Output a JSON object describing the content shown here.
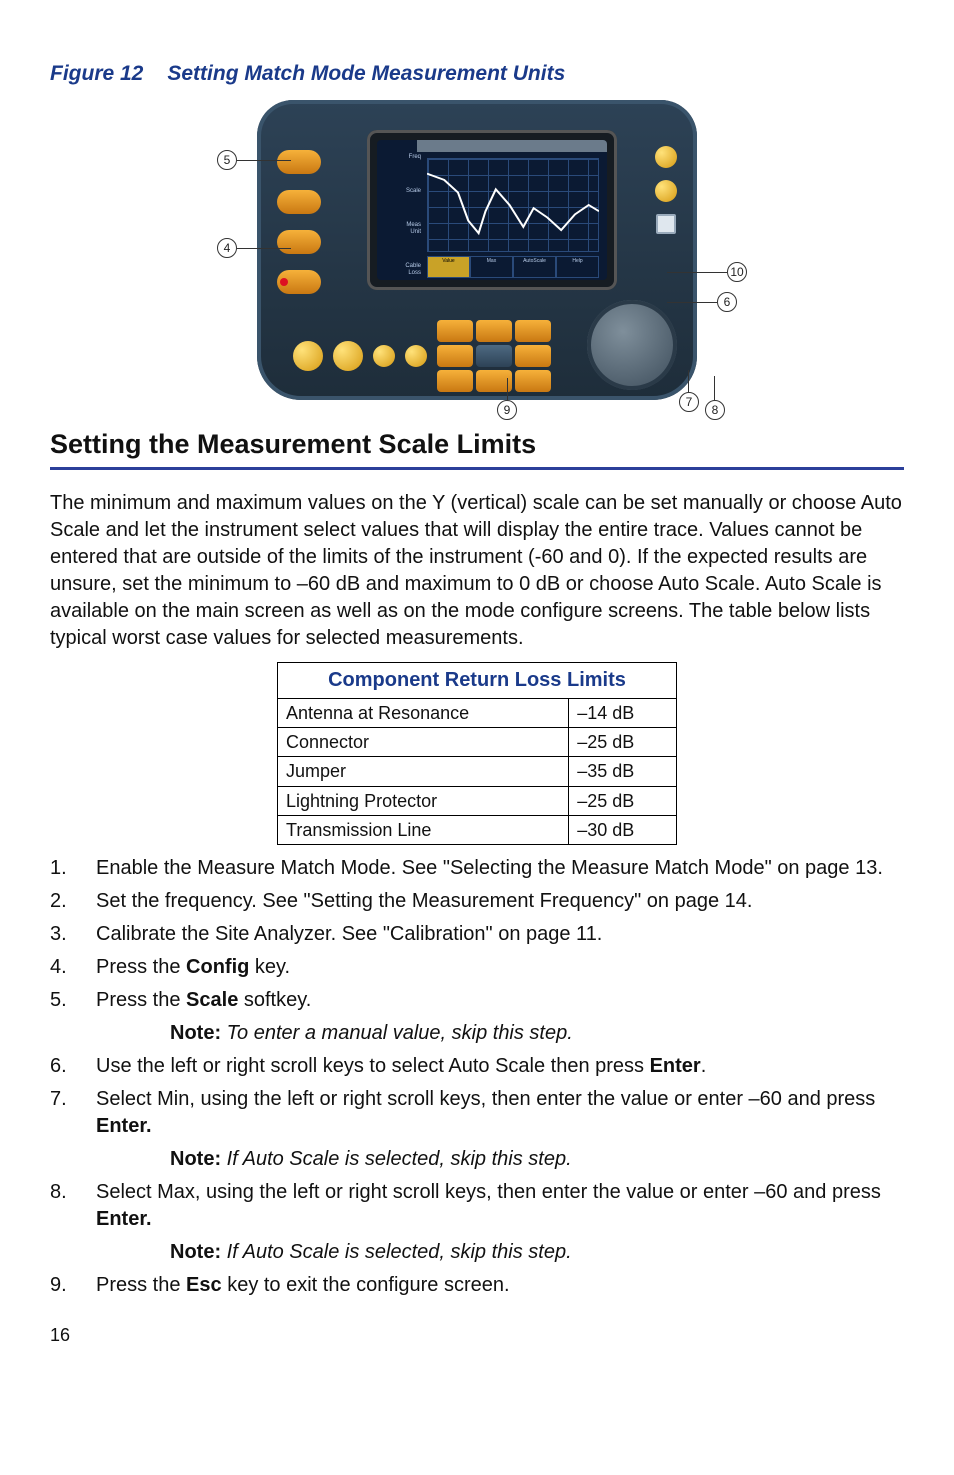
{
  "figure": {
    "label": "Figure 12",
    "title": "Setting Match Mode Measurement Units",
    "callouts": {
      "c4": "4",
      "c5": "5",
      "c6": "6",
      "c7": "7",
      "c8": "8",
      "c9": "9",
      "c10": "10"
    }
  },
  "section_heading": "Setting the Measurement Scale Limits",
  "intro": "The minimum and maximum values on the Y (vertical) scale can be set manually or choose Auto Scale and let the instrument select values that will display the entire trace. Values cannot be entered that are outside of the limits of the instrument (-60 and 0). If the expected results are unsure, set the minimum to –60 dB and maximum to 0 dB or choose Auto Scale. Auto Scale is available on the main screen as well as on the mode configure screens. The table below lists typical worst case values for selected measurements.",
  "table": {
    "title": "Component Return Loss Limits",
    "rows": [
      {
        "name": "Antenna at Resonance",
        "value": "–14 dB"
      },
      {
        "name": "Connector",
        "value": "–25 dB"
      },
      {
        "name": "Jumper",
        "value": "–35 dB"
      },
      {
        "name": "Lightning Protector",
        "value": "–25 dB"
      },
      {
        "name": "Transmission Line",
        "value": "–30 dB"
      }
    ]
  },
  "steps": {
    "s1a": "Enable the Measure Match Mode. See \"Selecting the Measure Match Mode\" on page 13.",
    "s2": "Set the frequency. See \"Setting the Measurement Frequency\" on page 14.",
    "s3": "Calibrate the Site Analyzer. See \"Calibration\" on page 11.",
    "s4a": "Press the ",
    "s4b": "Config",
    "s4c": " key.",
    "s5a": "Press the ",
    "s5b": "Scale",
    "s5c": " softkey.",
    "s6a": "Use the left or right scroll keys to select Auto Scale then press ",
    "s6b": "Enter",
    "s6c": ".",
    "s7a": "Select Min, using the left or right scroll keys, then enter the value or enter –60 and press ",
    "s7b": "Enter.",
    "s7c": "",
    "s8a": "Select Max, using the left or right scroll keys, then enter the value or enter –60 and press ",
    "s8b": "Enter.",
    "s8c": "",
    "s9a": "Press the ",
    "s9b": "Esc",
    "s9c": " key to exit the configure screen."
  },
  "notes": {
    "label": "Note:",
    "n1": "To enter a manual value, skip this step.",
    "n2": "If Auto Scale is selected, skip this step.",
    "n3": "If Auto Scale is selected, skip this step."
  },
  "page": "16"
}
